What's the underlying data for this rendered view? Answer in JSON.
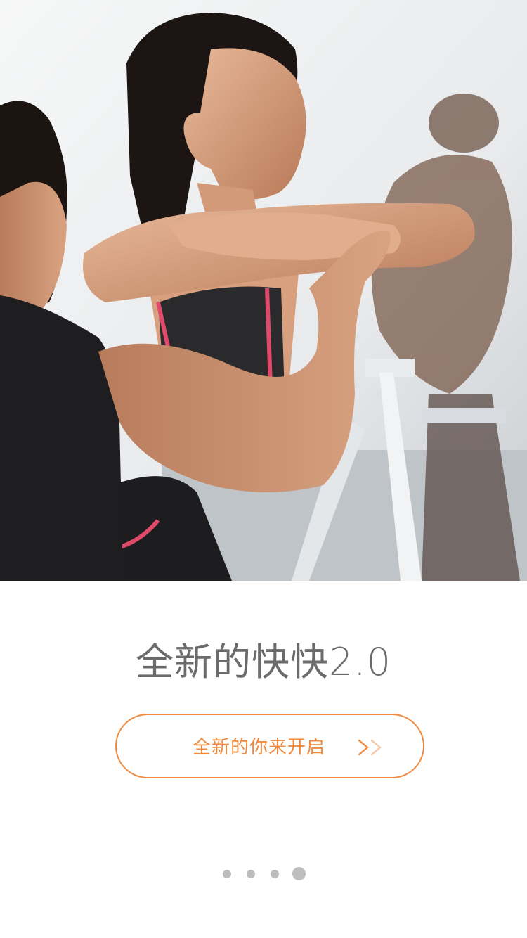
{
  "hero": {
    "photo_description_icon": "fitness-photo"
  },
  "title": "全新的快快2.0",
  "start_button": {
    "label": "全新的你来开启",
    "icon": "double-chevron-right-icon"
  },
  "pager": {
    "count": 4,
    "active_index": 3
  },
  "colors": {
    "accent": "#f08a3e",
    "title_text": "#6b6b6b",
    "dot_inactive": "#bdbdbd",
    "dot_active": "#bdbdbd"
  }
}
